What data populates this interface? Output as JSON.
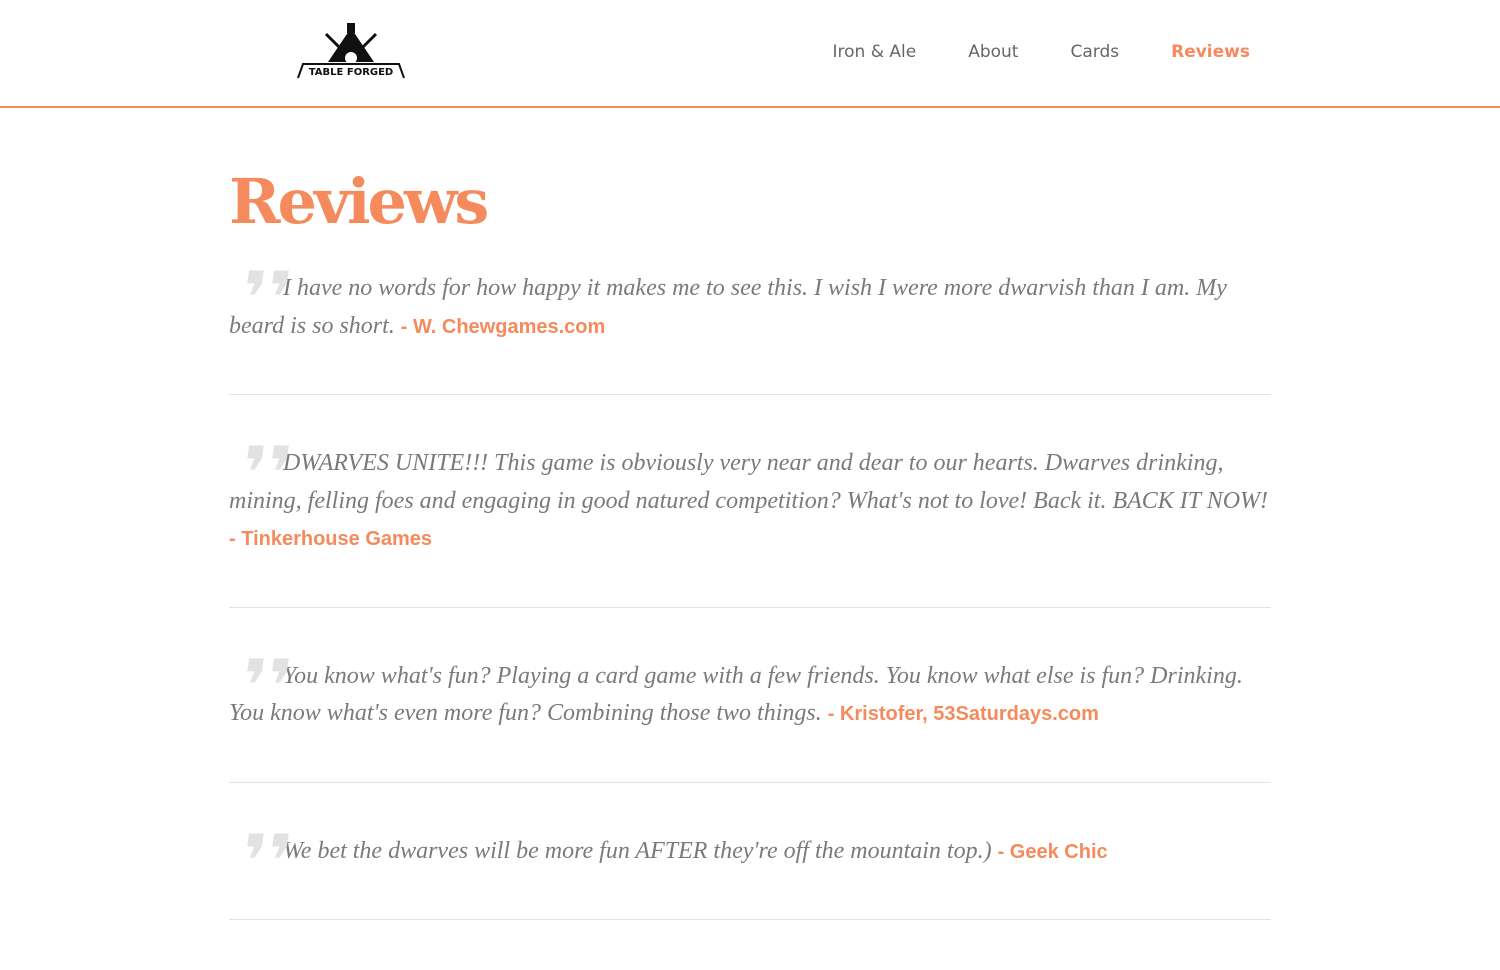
{
  "logo": {
    "text": "TABLE FORGED"
  },
  "nav": [
    {
      "label": "Iron & Ale"
    },
    {
      "label": "About"
    },
    {
      "label": "Cards"
    },
    {
      "label": "Reviews"
    }
  ],
  "page_title": "Reviews",
  "reviews": [
    {
      "text": "I have no words for how happy it makes me to see this. I wish I were more dwarvish than I am. My beard is so short.",
      "author": "- W. Chewgames.com"
    },
    {
      "text": "DWARVES UNITE!!! This game is obviously very near and dear to our hearts. Dwarves drinking, mining, felling foes and engaging in good natured competition? What's not to love! Back it. BACK IT NOW!",
      "author": "- Tinkerhouse Games"
    },
    {
      "text": "You know what's fun? Playing a card game with a few friends. You know what else is fun? Drinking. You know what's even more fun? Combining those two things.",
      "author": "- Kristofer, 53Saturdays.com"
    },
    {
      "text": "We bet the dwarves will be more fun AFTER they're off the mountain top.)",
      "author": "- Geek Chic"
    }
  ],
  "colors": {
    "accent": "#f58a5c",
    "text": "#7a7a7a"
  }
}
